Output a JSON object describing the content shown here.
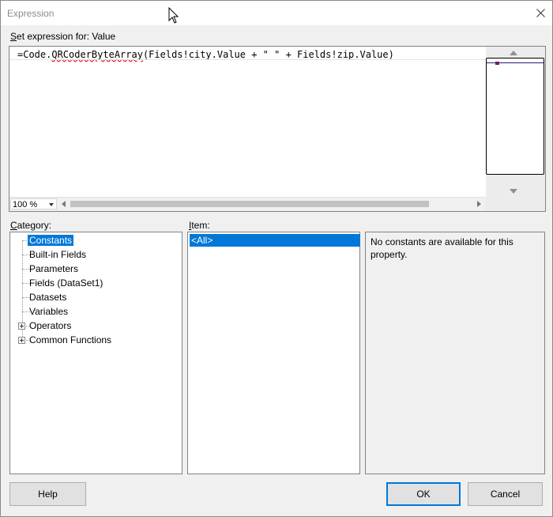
{
  "window": {
    "title": "Expression"
  },
  "expression": {
    "label_underlined": "S",
    "label_rest": "et expression for: Value",
    "code_prefix": "=Code.",
    "code_func": "QRCoderByteArray",
    "code_suffix": "(Fields!city.Value + \" \" + Fields!zip.Value)",
    "zoom": "100 %"
  },
  "category": {
    "label_underlined": "C",
    "label_rest": "ategory:",
    "items": [
      {
        "label": "Constants",
        "selected": true,
        "expandable": false
      },
      {
        "label": "Built-in Fields",
        "selected": false,
        "expandable": false
      },
      {
        "label": "Parameters",
        "selected": false,
        "expandable": false
      },
      {
        "label": "Fields (DataSet1)",
        "selected": false,
        "expandable": false
      },
      {
        "label": "Datasets",
        "selected": false,
        "expandable": false
      },
      {
        "label": "Variables",
        "selected": false,
        "expandable": false
      },
      {
        "label": "Operators",
        "selected": false,
        "expandable": true
      },
      {
        "label": "Common Functions",
        "selected": false,
        "expandable": true
      }
    ]
  },
  "item": {
    "label_underlined": "I",
    "label_rest": "tem:",
    "selected": "<All>"
  },
  "description": {
    "text": "No constants are available for this property."
  },
  "buttons": {
    "help": "Help",
    "ok": "OK",
    "cancel": "Cancel"
  }
}
